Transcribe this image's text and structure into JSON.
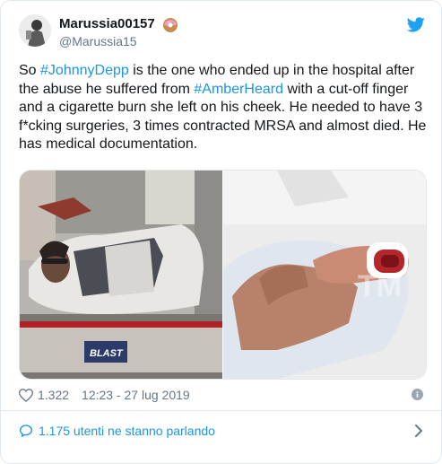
{
  "tweet": {
    "display_name": "Marussia00157",
    "handle": "@Marussia15",
    "text_parts": [
      {
        "text": "So ",
        "hashtag": false
      },
      {
        "text": "#JohnnyDepp",
        "hashtag": true
      },
      {
        "text": " is the one who ended up in the hospital after the abuse he suffered from ",
        "hashtag": false
      },
      {
        "text": "#AmberHeard",
        "hashtag": true
      },
      {
        "text": " with a cut-off finger and a cigarette burn she left on his cheek. He needed to have 3 f*cking surgeries, 3 times contracted MRSA and almost died. He has medical documentation.",
        "hashtag": false
      }
    ],
    "media": {
      "left_watermark": "BLAST",
      "right_watermark": "TM"
    },
    "likes": "1.322",
    "timestamp": "12:23 - 27 lug 2019",
    "conversation": "1.175 utenti ne stanno parlando"
  },
  "colors": {
    "link": "#1b95e0",
    "twitter_blue": "#1da1f2",
    "muted": "#657786",
    "border": "#e1e8ed"
  },
  "icons": {
    "brand": "twitter-bird-icon",
    "emoji": "donut-emoji",
    "like": "heart-icon",
    "info": "info-icon",
    "reply": "speech-bubble-icon",
    "chevron": "chevron-right-icon"
  }
}
